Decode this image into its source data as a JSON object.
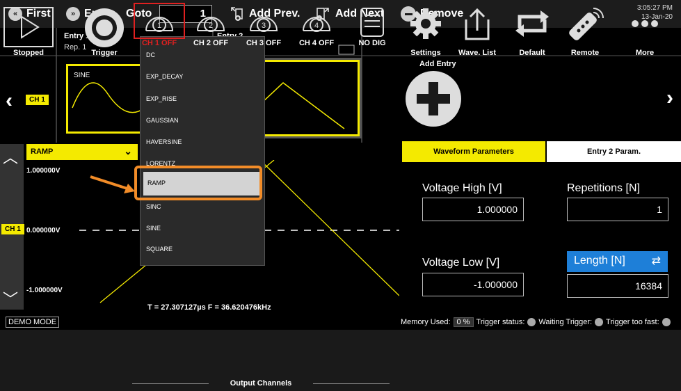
{
  "topbar": {
    "first_label": "First",
    "end_label": "End",
    "goto_label": "Goto",
    "goto_value": "1",
    "add_prev_label": "Add Prev.",
    "add_next_label": "Add Next",
    "remove_label": "Remove",
    "time": "3:05:27 PM",
    "date": "13-Jan-20"
  },
  "entries": {
    "entry1_title": "Entry 1",
    "entry1_rep": "Rep. 1",
    "entry1_wave": "SINE",
    "entry2_title": "Entry 2",
    "channel_tag": "CH 1",
    "add_entry_label": "Add Entry"
  },
  "dropdown": {
    "items": [
      "DC",
      "EXP_DECAY",
      "EXP_RISE",
      "GAUSSIAN",
      "HAVERSINE",
      "LORENTZ",
      "RAMP",
      "SINC",
      "SINE",
      "SQUARE"
    ],
    "selected": "RAMP"
  },
  "waveform": {
    "selected": "RAMP",
    "v_high": "1.000000V",
    "v_zero": "0.000000V",
    "v_low": "-1.000000V",
    "channel_tag": "CH 1",
    "readout": "T = 27.307127µs  F = 36.620476kHz",
    "demo_mode": "DEMO MODE"
  },
  "params": {
    "tab_waveform": "Waveform Parameters",
    "tab_entry": "Entry 2 Param.",
    "voltage_high_label": "Voltage High [V]",
    "voltage_high_value": "1.000000",
    "repetitions_label": "Repetitions [N]",
    "repetitions_value": "1",
    "voltage_low_label": "Voltage Low [V]",
    "voltage_low_value": "-1.000000",
    "length_label": "Length [N]",
    "length_value": "16384"
  },
  "status": {
    "memory_label": "Memory Used:",
    "memory_value": "0 %",
    "trigger_status_label": "Trigger status:",
    "waiting_label": "Waiting Trigger:",
    "too_fast_label": "Trigger too fast:"
  },
  "bottombar": {
    "stopped": "Stopped",
    "trigger": "Trigger",
    "ch1": "CH 1 OFF",
    "ch2": "CH 2 OFF",
    "ch3": "CH 3 OFF",
    "ch4": "CH 4 OFF",
    "no_dig": "NO DIG",
    "output_channels": "Output Channels",
    "settings": "Settings",
    "wave_list": "Wave. List",
    "default": "Default",
    "remote": "Remote",
    "more": "More"
  },
  "colors": {
    "accent_yellow": "#f4ea00",
    "accent_blue": "#1e7fd8",
    "highlight_orange": "#f28c28",
    "ch1_red": "#e02020"
  }
}
